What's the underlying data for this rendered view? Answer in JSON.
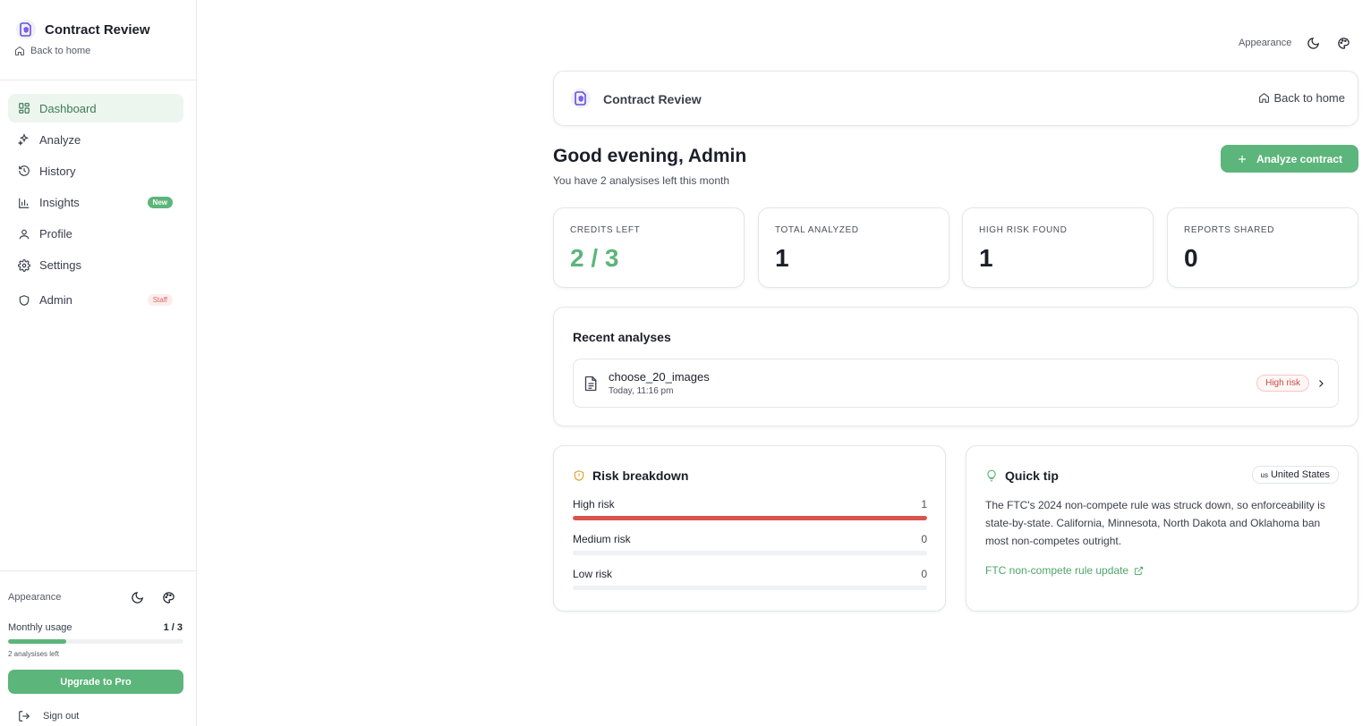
{
  "app": {
    "title": "Contract Review",
    "back_home": "Back to home"
  },
  "sidebar": {
    "items": [
      {
        "label": "Dashboard"
      },
      {
        "label": "Analyze"
      },
      {
        "label": "History"
      },
      {
        "label": "Insights",
        "badge": "New"
      },
      {
        "label": "Profile"
      },
      {
        "label": "Settings"
      },
      {
        "label": "Admin",
        "badge": "Staff"
      }
    ],
    "appearance_label": "Appearance",
    "usage": {
      "label": "Monthly usage",
      "count": "1 / 3",
      "fraction": 0.333,
      "left_text": "2 analysises left"
    },
    "upgrade_label": "Upgrade to Pro",
    "signout_label": "Sign out"
  },
  "topbar": {
    "appearance_label": "Appearance"
  },
  "header_card": {
    "title": "Contract Review",
    "back_home": "Back to home"
  },
  "greeting": {
    "title": "Good evening, Admin",
    "subtitle": "You have 2 analysises left this month",
    "analyze_label": "Analyze contract"
  },
  "stats": [
    {
      "label": "CREDITS LEFT",
      "value": "2 / 3"
    },
    {
      "label": "TOTAL ANALYZED",
      "value": "1"
    },
    {
      "label": "HIGH RISK FOUND",
      "value": "1"
    },
    {
      "label": "REPORTS SHARED",
      "value": "0"
    }
  ],
  "recent": {
    "title": "Recent analyses",
    "items": [
      {
        "name": "choose_20_images",
        "date": "Today, 11:16 pm",
        "risk": "High risk"
      }
    ]
  },
  "risk_breakdown": {
    "title": "Risk breakdown",
    "rows": [
      {
        "label": "High risk",
        "count": "1",
        "fraction": 1.0,
        "color": "#d9534f"
      },
      {
        "label": "Medium risk",
        "count": "0",
        "fraction": 0,
        "color": "#e0a030"
      },
      {
        "label": "Low risk",
        "count": "0",
        "fraction": 0,
        "color": "#5cb57a"
      }
    ]
  },
  "quick_tip": {
    "title": "Quick tip",
    "region_flag": "us",
    "region": "United States",
    "body": "The FTC's 2024 non-compete rule was struck down, so enforceability is state-by-state. California, Minnesota, North Dakota and Oklahoma ban most non-competes outright.",
    "link_label": "FTC non-compete rule update"
  },
  "colors": {
    "accent": "#5cb57a",
    "danger": "#d9534f",
    "active_bg": "#ecf6ef"
  }
}
